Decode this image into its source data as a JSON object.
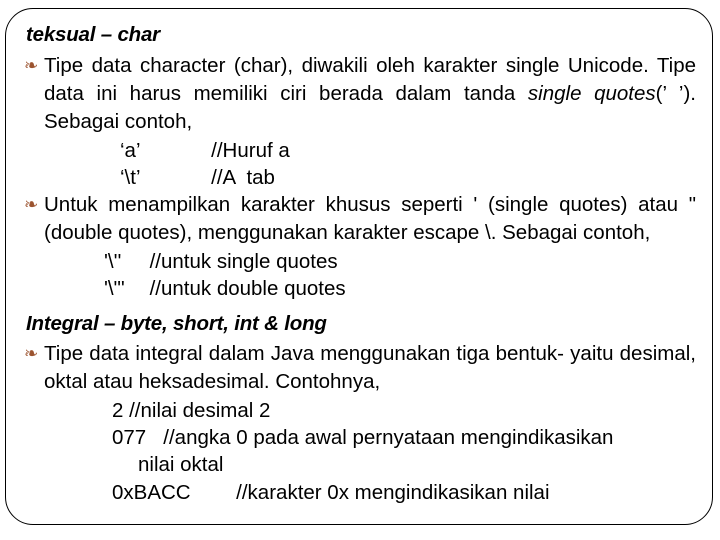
{
  "slide": {
    "frame_color": "#000000",
    "bullet_color": "#9C5430",
    "bullet_glyph": "❧",
    "sections": [
      {
        "heading": "teksual – char",
        "bullets": [
          {
            "parts": [
              {
                "text": "Tipe  data  character  (char),  diwakili  oleh  karakter  single Unicode.  Tipe  data  ini  harus memiliki ciri berada dalam tanda ",
                "style": "normal"
              },
              {
                "text": "single quotes",
                "style": "italic"
              },
              {
                "text": "(’ ’). Sebagai contoh,",
                "style": "normal"
              }
            ]
          }
        ],
        "examples": [
          {
            "code": "‘a’",
            "comment": "//Huruf a",
            "indent": "indent-1"
          },
          {
            "code": "‘\\t’",
            "comment": "//A  tab",
            "indent": "indent-1"
          }
        ],
        "bullets2": [
          {
            "parts": [
              {
                "text": "Untuk   menampilkan   karakter   khusus   seperti   '   (single quotes)   atau   \"   (double   quotes), menggunakan karakter escape \\. Sebagai contoh,",
                "style": "normal"
              }
            ]
          }
        ],
        "examples2": [
          {
            "code": "'\\''",
            "comment": "//untuk single quotes",
            "indent": "indent-2"
          },
          {
            "code": "'\\\"'",
            "comment": "//untuk double quotes",
            "indent": "indent-2"
          }
        ]
      },
      {
        "heading": "Integral – byte, short, int & long",
        "bullets": [
          {
            "parts": [
              {
                "text": "Tipe  data  integral  dalam  Java  menggunakan  tiga  bentuk- yaitu  desimal,  oktal  atau heksadesimal. Contohnya,",
                "style": "normal"
              }
            ]
          }
        ],
        "examples": [
          {
            "code": "2 //nilai desimal 2",
            "comment": "",
            "indent": "indent-3"
          },
          {
            "code": "077   //angka 0 pada awal pernyataan mengindikasikan",
            "comment": "",
            "indent": "indent-3",
            "wrap": "nilai oktal"
          },
          {
            "code": "0xBACC        //karakter 0x mengindikasikan nilai",
            "comment": "",
            "indent": "indent-3",
            "clipped": true
          }
        ]
      }
    ]
  }
}
